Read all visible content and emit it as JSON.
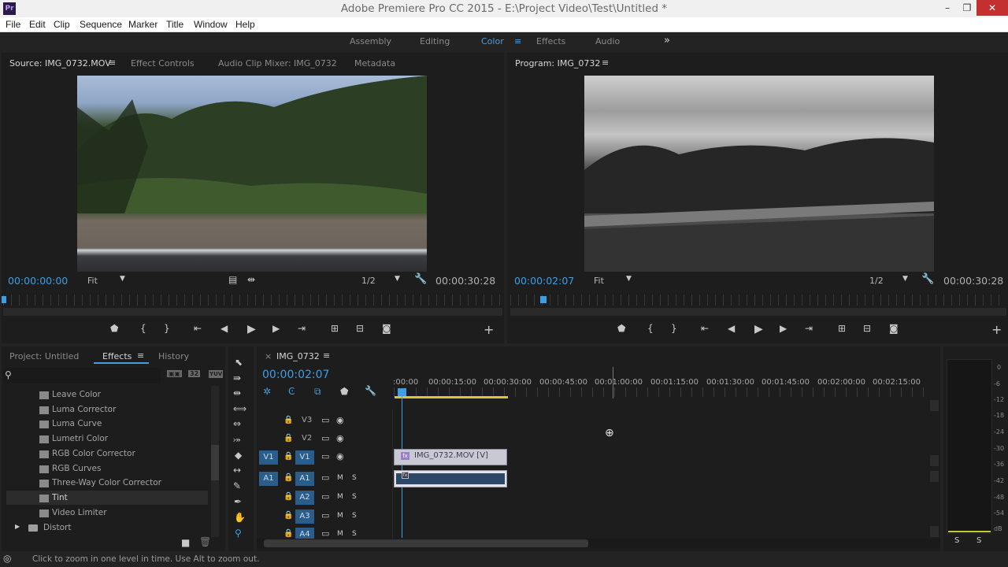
{
  "window": {
    "title": "Adobe Premiere Pro CC 2015 - E:\\Project Video\\Test\\Untitled *",
    "logo_text": "Pr"
  },
  "menu": [
    "File",
    "Edit",
    "Clip",
    "Sequence",
    "Marker",
    "Title",
    "Window",
    "Help"
  ],
  "workspaces": {
    "items": [
      "Assembly",
      "Editing",
      "Color",
      "Effects",
      "Audio"
    ],
    "active": "Color",
    "more": "»"
  },
  "source_panel": {
    "tabs": [
      "Source: IMG_0732.MOV",
      "Effect Controls",
      "Audio Clip Mixer: IMG_0732",
      "Metadata"
    ],
    "timecode": "00:00:00:00",
    "fit": "Fit",
    "resolution": "1/2",
    "duration": "00:00:30:28"
  },
  "program_panel": {
    "tab": "Program: IMG_0732",
    "timecode": "00:00:02:07",
    "fit": "Fit",
    "resolution": "1/2",
    "duration": "00:00:30:28"
  },
  "project_panel": {
    "tabs": [
      "Project: Untitled",
      "Effects",
      "History"
    ],
    "active_tab": "Effects",
    "items": [
      "Leave Color",
      "Luma Corrector",
      "Luma Curve",
      "Lumetri Color",
      "RGB Color Corrector",
      "RGB Curves",
      "Three-Way Color Corrector",
      "Tint",
      "Video Limiter"
    ],
    "selected_item": "Tint",
    "folder": "Distort",
    "filter_badges": [
      "32",
      "YUV"
    ]
  },
  "timeline": {
    "tab": "IMG_0732",
    "timecode": "00:00:02:07",
    "ruler": [
      ":00:00",
      "00:00:15:00",
      "00:00:30:00",
      "00:00:45:00",
      "00:01:00:00",
      "00:01:15:00",
      "00:01:30:00",
      "00:01:45:00",
      "00:02:00:00",
      "00:02:15:00"
    ],
    "video_tracks": [
      "V3",
      "V2",
      "V1"
    ],
    "audio_tracks": [
      "A1",
      "A2",
      "A3",
      "A4"
    ],
    "source_patch_video": "V1",
    "source_patch_audio": "A1",
    "track_mute": "M",
    "track_solo": "S",
    "video_clip": "IMG_0732.MOV [V]",
    "clip_badge": "fx"
  },
  "meter": {
    "labels": [
      "0",
      "-6",
      "-12",
      "-18",
      "-24",
      "-30",
      "-36",
      "-42",
      "-48",
      "-54",
      "dB"
    ],
    "solo": [
      "S",
      "S"
    ]
  },
  "status": {
    "text": "Click to zoom in one level in time. Use Alt to zoom out."
  },
  "colors": {
    "accent": "#3d9ee5",
    "panel": "#1d1d1d",
    "track_blue": "#2a5d8a"
  }
}
